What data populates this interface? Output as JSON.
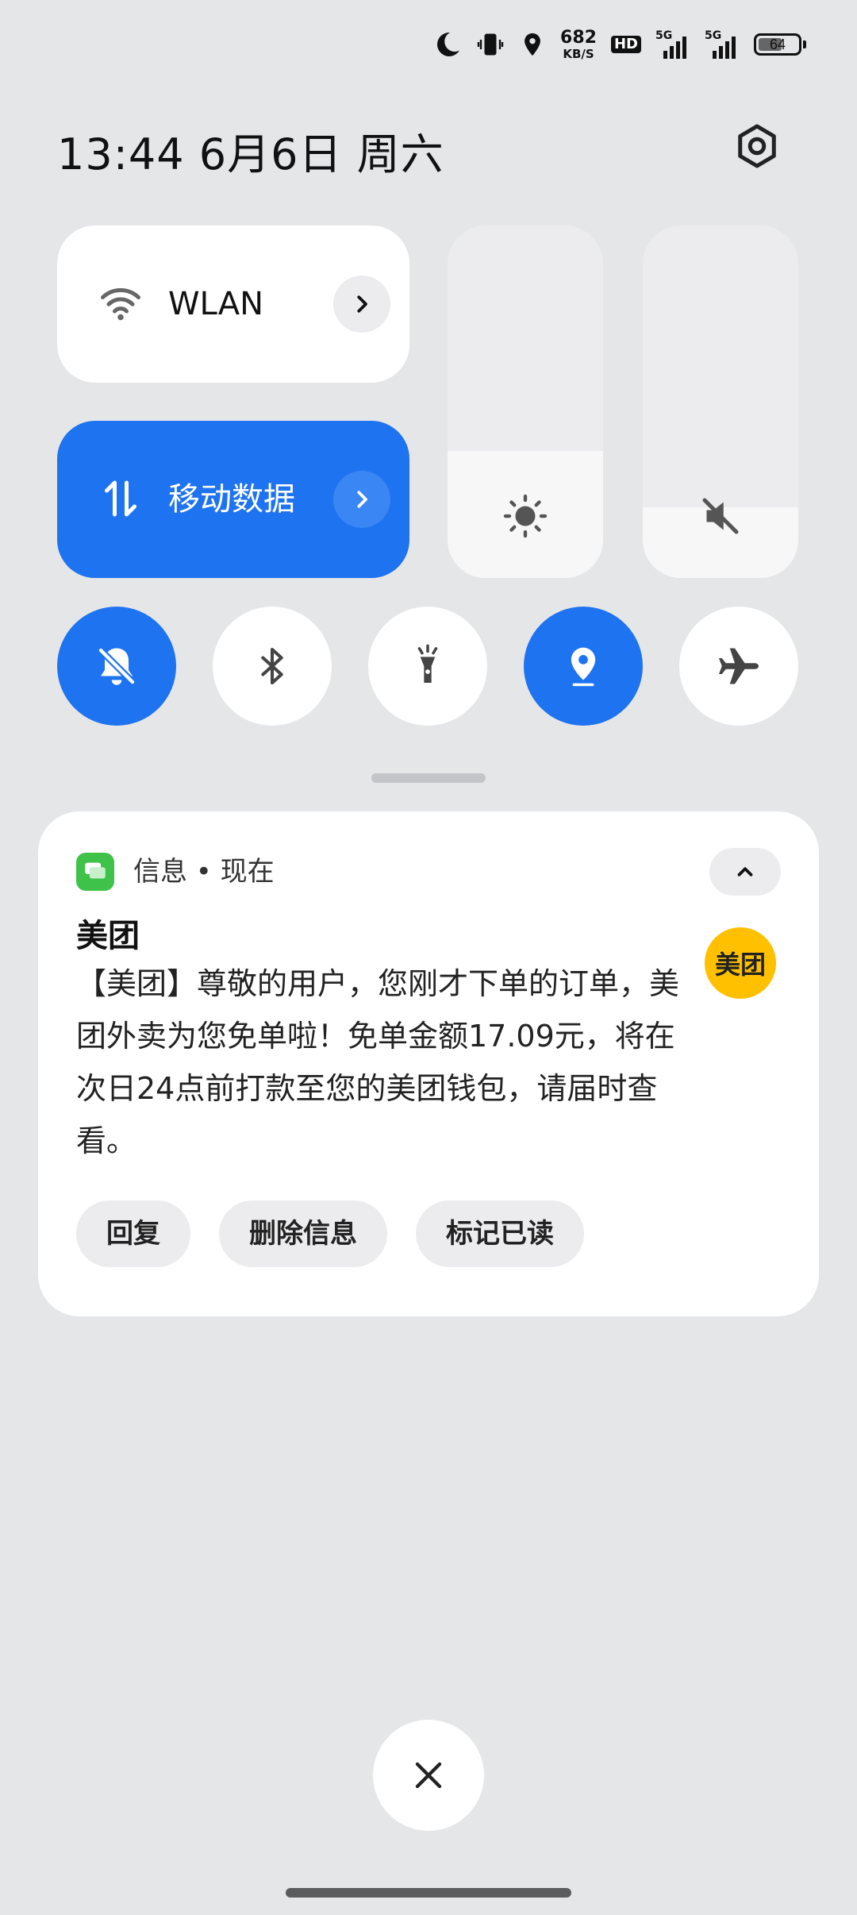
{
  "status_bar": {
    "speed_value": "682",
    "speed_unit": "KB/S",
    "hd_label": "HD",
    "sim1_label": "5G",
    "sim2_label": "5G",
    "battery_percent": "64",
    "battery_level": 0.64,
    "icons": [
      "moon-icon",
      "vibrate-icon",
      "location-icon",
      "hd-icon",
      "signal-icon",
      "signal-icon",
      "battery-icon"
    ]
  },
  "header": {
    "datetime": "13:44  6月6日 周六",
    "settings_icon": "gear-icon"
  },
  "quick_tiles": {
    "wlan": {
      "label": "WLAN",
      "icon": "wifi-icon",
      "active": false
    },
    "mobile_data": {
      "label": "移动数据",
      "icon": "data-arrows-icon",
      "active": true
    },
    "brightness_level": 0.36,
    "volume_level": 0.2
  },
  "toggles": [
    {
      "name": "mute-toggle",
      "icon": "bell-off-icon",
      "active": true
    },
    {
      "name": "bluetooth-toggle",
      "icon": "bluetooth-icon",
      "active": false
    },
    {
      "name": "flashlight-toggle",
      "icon": "flashlight-icon",
      "active": false
    },
    {
      "name": "location-toggle",
      "icon": "location-icon",
      "active": true
    },
    {
      "name": "airplane-toggle",
      "icon": "airplane-icon",
      "active": false
    }
  ],
  "notification": {
    "app_line": "信息 • 现在",
    "sender": "美团",
    "message": "【美团】尊敬的用户，您刚才下单的订单，美团外卖为您免单啦！免单金额17.09元，将在次日24点前打款至您的美团钱包，请届时查看。",
    "avatar_text": "美团",
    "actions": {
      "reply": "回复",
      "delete": "删除信息",
      "mark_read": "标记已读"
    },
    "colors": {
      "avatar": "#ffc000",
      "app_icon": "#3fc24a"
    }
  },
  "colors": {
    "accent": "#1e73f0"
  }
}
